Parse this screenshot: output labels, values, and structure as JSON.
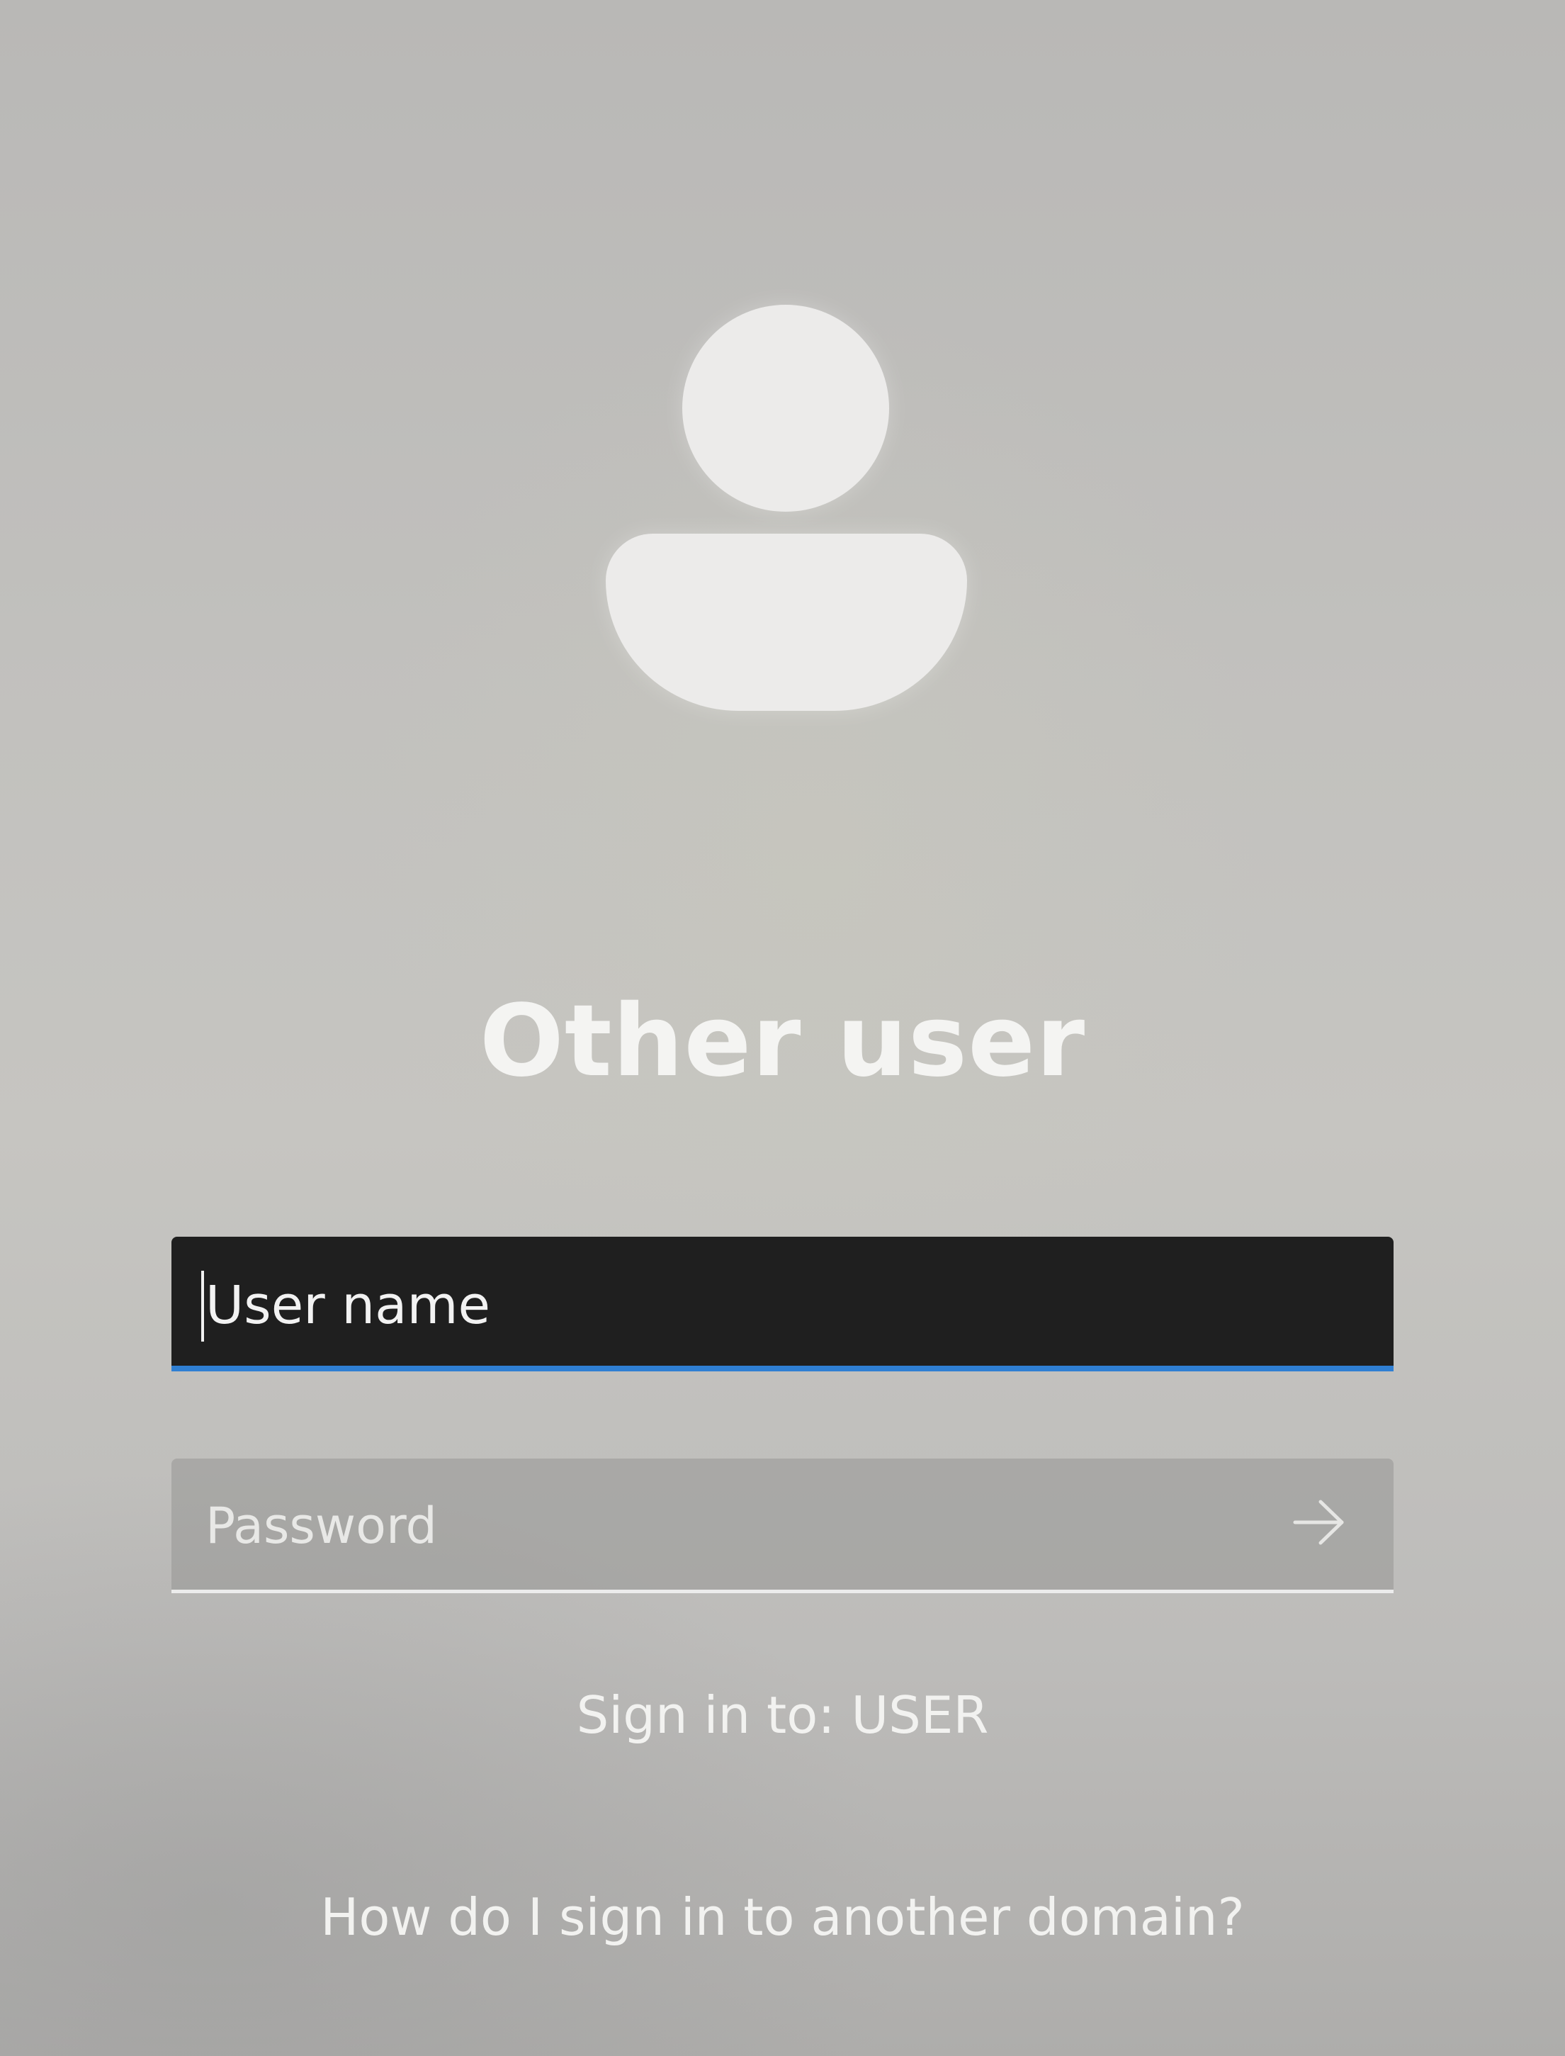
{
  "lock_screen": {
    "avatar_icon": "user-silhouette-icon",
    "title": "Other user",
    "username_field": {
      "placeholder": "User name",
      "value": ""
    },
    "password_field": {
      "placeholder": "Password",
      "value": "",
      "submit_icon": "arrow-right-icon"
    },
    "sign_in_to": "Sign in to: USER",
    "help_link": "How do I sign in to another domain?"
  },
  "colors": {
    "username_focus_underline": "#2f7fd3",
    "username_background": "#1f1f1f"
  }
}
